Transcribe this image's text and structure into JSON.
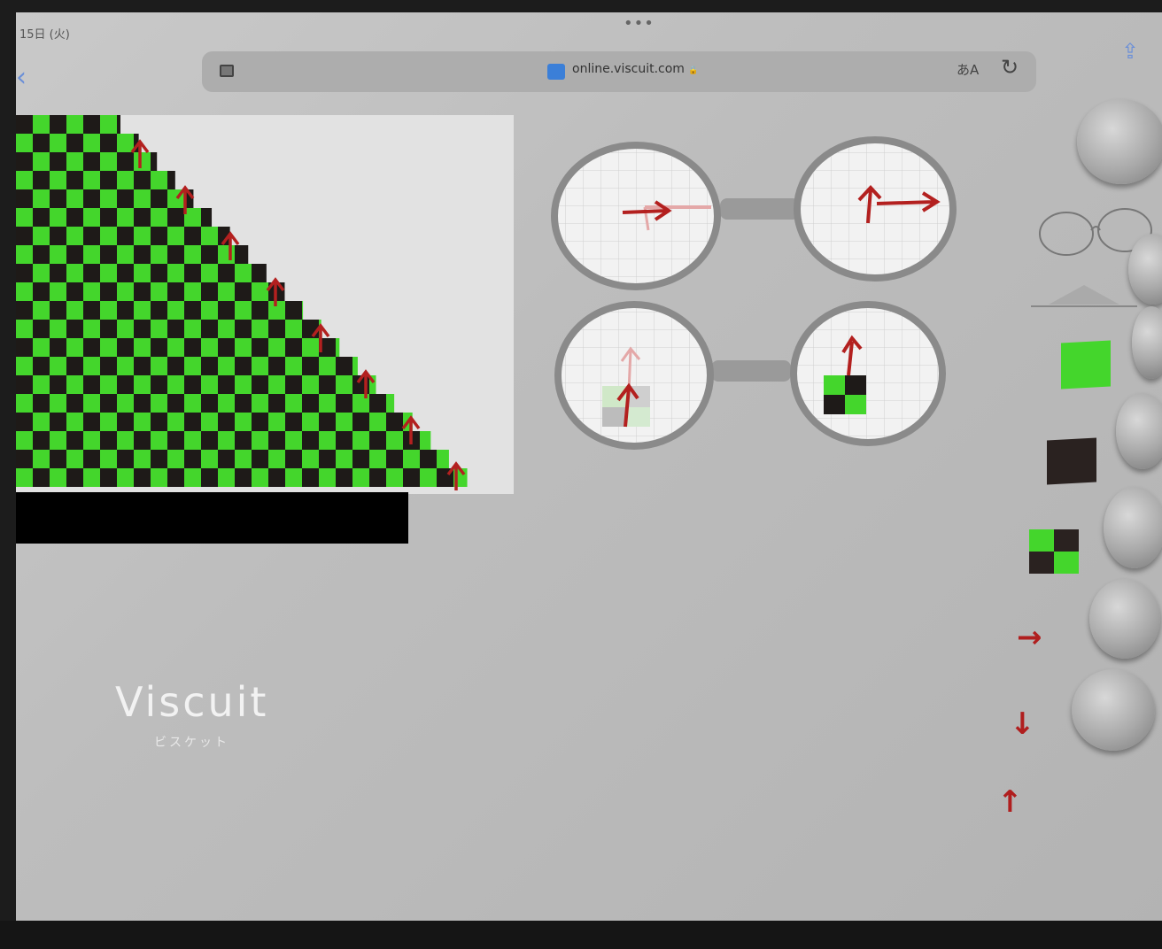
{
  "status": {
    "time": "15日 (火)",
    "dots": "•••"
  },
  "browser": {
    "back_glyph": "‹",
    "url": "online.viscuit.com",
    "lock_glyph": "🔒",
    "text_size": "あA",
    "reload_glyph": "↻",
    "share_glyph": "⇪"
  },
  "icons": {
    "tabs": "tabs-icon",
    "site": "site-favicon-icon",
    "share": "share-icon",
    "reload": "reload-icon"
  },
  "colors": {
    "green": "#44d62c",
    "dark": "#1e1a18",
    "arrow": "#b3201f"
  },
  "app": {
    "logo": "Viscuit",
    "logo_sub": "ビスケット"
  },
  "palette": {
    "arrows": [
      "→",
      "↓",
      "↑"
    ]
  }
}
